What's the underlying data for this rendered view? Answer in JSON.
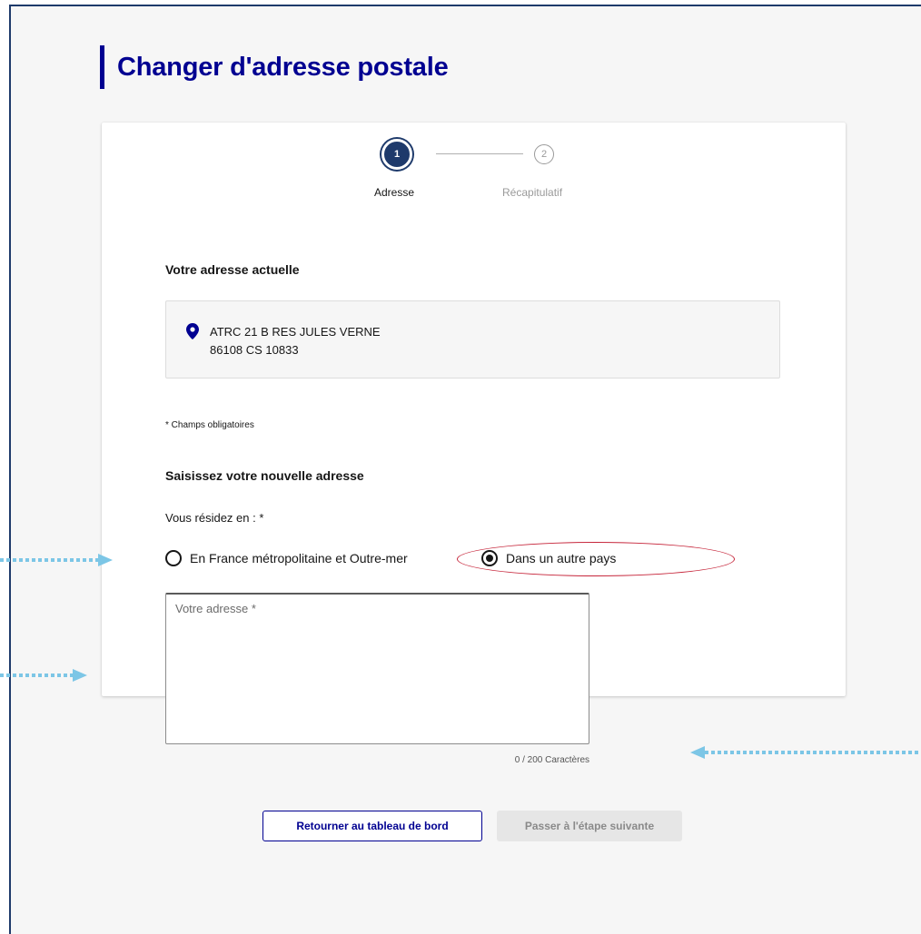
{
  "page": {
    "title": "Changer d'adresse postale"
  },
  "stepper": {
    "steps": [
      {
        "number": "1",
        "label": "Adresse",
        "active": true
      },
      {
        "number": "2",
        "label": "Récapitulatif",
        "active": false
      }
    ]
  },
  "current_address": {
    "title": "Votre adresse actuelle",
    "line1": "ATRC 21 B RES JULES VERNE",
    "line2": "86108 CS 10833",
    "icon": "map-pin-icon"
  },
  "form": {
    "required_note": "* Champs obligatoires",
    "new_address_title": "Saisissez votre nouvelle adresse",
    "reside_label": "Vous résidez en : *",
    "radio_options": [
      {
        "label": "En France métropolitaine et Outre-mer",
        "checked": false
      },
      {
        "label": "Dans un autre pays",
        "checked": true
      }
    ],
    "address_value": "",
    "address_placeholder": "Votre adresse *",
    "char_count": "0 / 200 Caractères"
  },
  "actions": {
    "back_label": "Retourner au tableau de bord",
    "next_label": "Passer à l'étape suivante"
  },
  "colors": {
    "primary": "#000091",
    "step_active": "#1e3a6b",
    "highlight": "#c6253a",
    "annotation_arrow": "#7cc6e6",
    "disabled_button": "#e6e6e6"
  }
}
